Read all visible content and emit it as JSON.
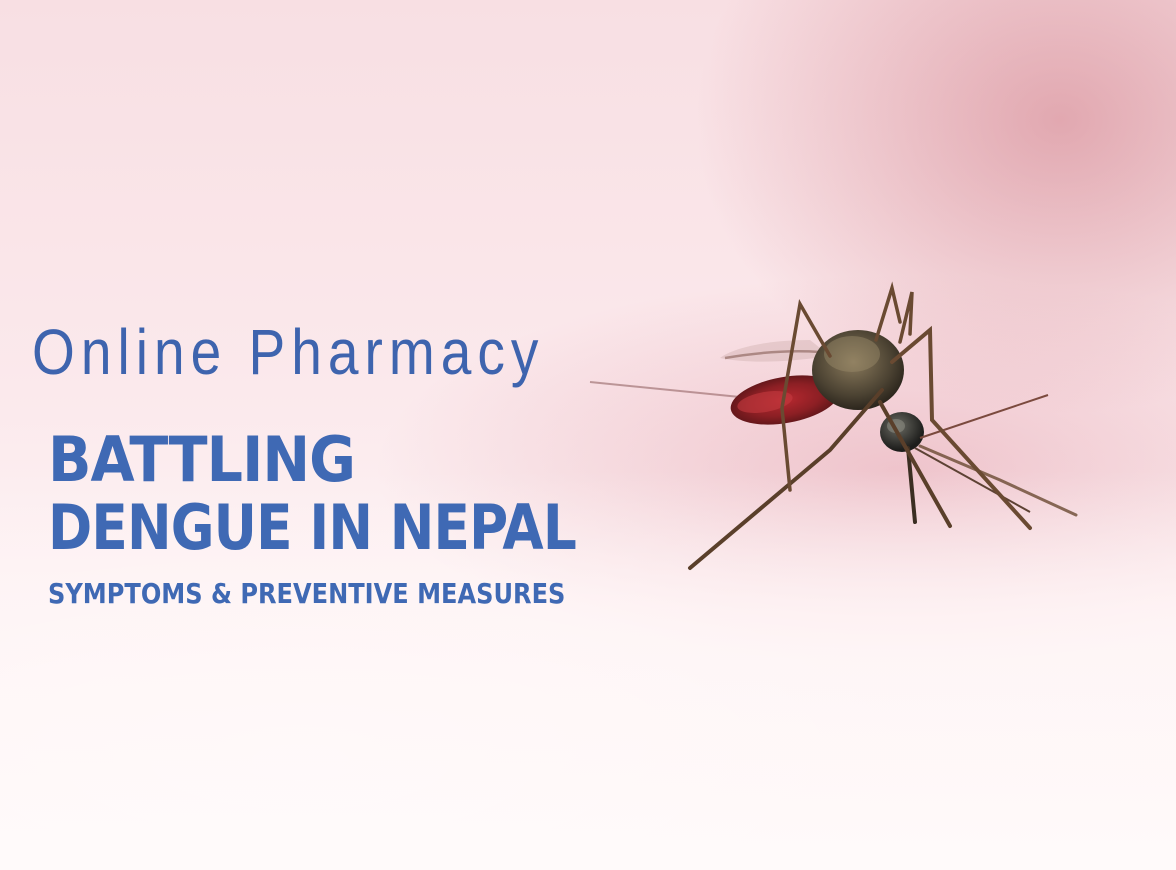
{
  "brand": {
    "name": "Online Pharmacy"
  },
  "headline": {
    "line1": "BATTLING",
    "line2": "DENGUE IN NEPAL"
  },
  "subheadline": "SYMPTOMS & PREVENTIVE MEASURES",
  "colors": {
    "text_blue": "#3f69b4",
    "background_pink": "#f8dfe3"
  },
  "image": {
    "subject_icon": "mosquito-icon"
  }
}
